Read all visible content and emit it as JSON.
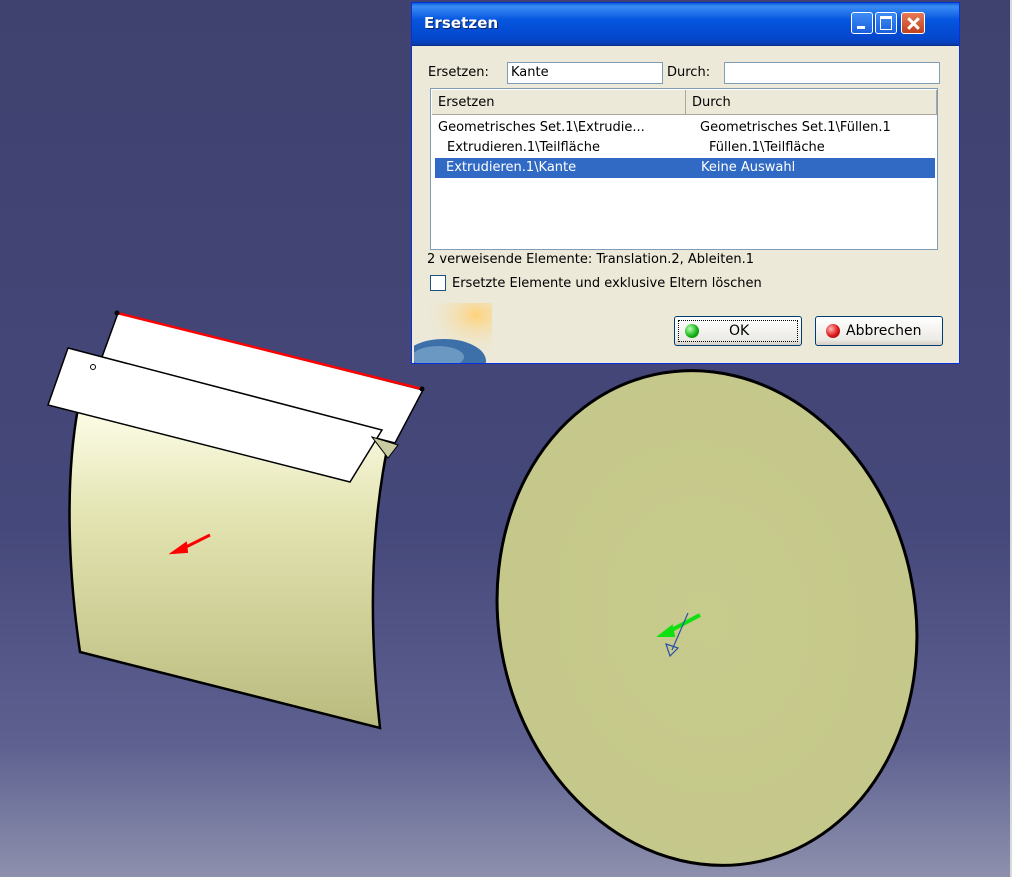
{
  "dialog": {
    "title": "Ersetzen",
    "replace_label": "Ersetzen:",
    "replace_value": "Kante",
    "with_label": "Durch:",
    "with_value": "",
    "columns": [
      "Ersetzen",
      "Durch"
    ],
    "rows": [
      {
        "ersetzen": "Geometrisches Set.1\\Extrudie...",
        "durch": "Geometrisches Set.1\\Füllen.1",
        "selected": false
      },
      {
        "ersetzen": "Extrudieren.1\\Teilfläche",
        "durch": "Füllen.1\\Teilfläche",
        "selected": false
      },
      {
        "ersetzen": "Extrudieren.1\\Kante",
        "durch": "Keine Auswahl",
        "selected": true
      }
    ],
    "referencing_text": "2 verweisende Elemente: Translation.2, Ableiten.1",
    "delete_checkbox_label": "Ersetzte Elemente und exklusive Eltern löschen",
    "delete_checkbox_checked": false,
    "ok_label": "OK",
    "cancel_label": "Abbrechen"
  },
  "viewport": {
    "background_top": "#3f416e",
    "background_bottom": "#8d90ad",
    "surface_color": "#c9cc8d",
    "highlight_edge_color": "#ff0000",
    "normal_arrow_color": "#ff0000",
    "disc_arrow_color": "#00e000"
  }
}
